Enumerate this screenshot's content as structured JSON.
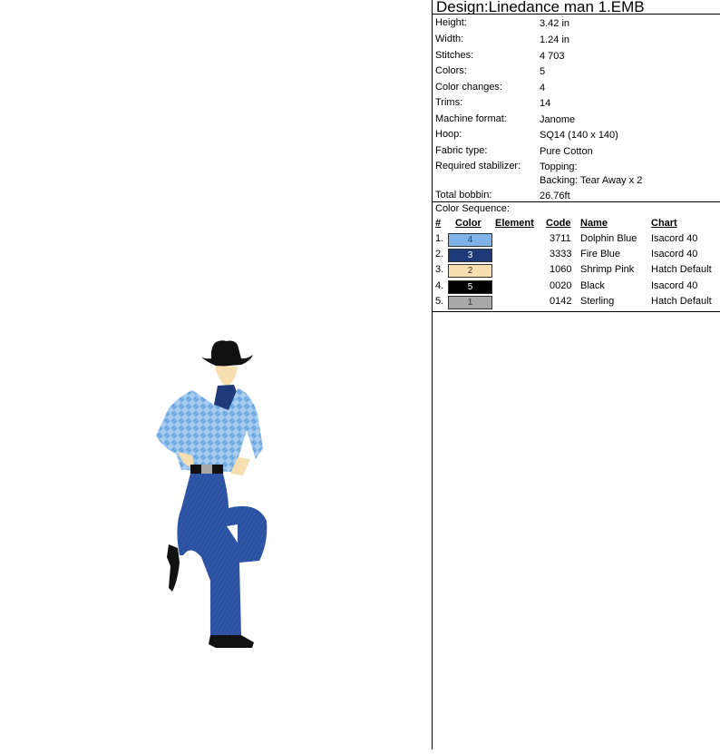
{
  "design": {
    "title": "Design:Linedance man 1.EMB"
  },
  "properties": [
    {
      "label": "Height:",
      "value": "3.42 in"
    },
    {
      "label": "Width:",
      "value": "1.24 in"
    },
    {
      "label": "Stitches:",
      "value": "4 703"
    },
    {
      "label": "Colors:",
      "value": "5"
    },
    {
      "label": "Color changes:",
      "value": "4"
    },
    {
      "label": "Trims:",
      "value": "14"
    },
    {
      "label": "Machine format:",
      "value": "Janome"
    },
    {
      "label": "Hoop:",
      "value": "SQ14 (140 x 140)"
    },
    {
      "label": "Fabric type:",
      "value": "Pure Cotton"
    },
    {
      "label": "Required stabilizer:",
      "value": "Topping:\nBacking: Tear Away x 2"
    },
    {
      "label": "Total bobbin:",
      "value": "26.76ft"
    }
  ],
  "color_sequence": {
    "title": "Color Sequence:",
    "headers": {
      "num": "#",
      "color": "Color",
      "element": "Element",
      "code": "Code",
      "name": "Name",
      "chart": "Chart"
    },
    "rows": [
      {
        "num": "1.",
        "swatch": "4",
        "swatch_color": "#7fb3e8",
        "swatch_text_color": "#1a3a6a",
        "code": "3711",
        "name": "Dolphin Blue",
        "chart": "Isacord 40"
      },
      {
        "num": "2.",
        "swatch": "3",
        "swatch_color": "#1f3a78",
        "swatch_text_color": "#ffffff",
        "code": "3333",
        "name": "Fire Blue",
        "chart": "Isacord 40"
      },
      {
        "num": "3.",
        "swatch": "2",
        "swatch_color": "#f6deb0",
        "swatch_text_color": "#333333",
        "code": "1060",
        "name": "Shrimp Pink",
        "chart": "Hatch Default"
      },
      {
        "num": "4.",
        "swatch": "5",
        "swatch_color": "#000000",
        "swatch_text_color": "#ffffff",
        "code": "0020",
        "name": "Black",
        "chart": "Isacord 40"
      },
      {
        "num": "5.",
        "swatch": "1",
        "swatch_color": "#a8a8a8",
        "swatch_text_color": "#333333",
        "code": "0142",
        "name": "Sterling",
        "chart": "Hatch Default"
      }
    ]
  }
}
